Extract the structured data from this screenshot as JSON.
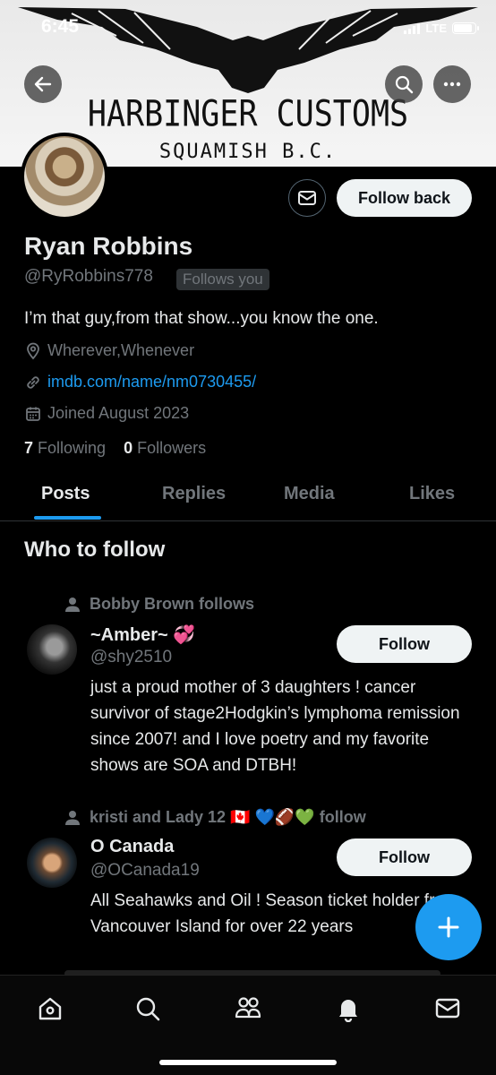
{
  "status_bar": {
    "time": "6:45",
    "network": "LTE"
  },
  "banner": {
    "line1": "HARBINGER CUSTOMS",
    "line2": "SQUAMISH B.C."
  },
  "icons": {
    "back": "back-arrow-icon",
    "search": "search-icon",
    "more": "more-icon",
    "message": "envelope-icon"
  },
  "profile": {
    "name": "Ryan Robbins",
    "handle": "@RyRobbins778",
    "follows_you": "Follows you",
    "bio": "I’m that guy,from that show...you know the one.",
    "location": "Wherever,Whenever",
    "website": "imdb.com/name/nm0730455/",
    "joined": "Joined August 2023",
    "following_count": "7",
    "following_label": "Following",
    "followers_count": "0",
    "followers_label": "Followers",
    "follow_back_label": "Follow back"
  },
  "tabs": [
    "Posts",
    "Replies",
    "Media",
    "Likes"
  ],
  "who_to_follow": {
    "title": "Who to follow",
    "suggestions": [
      {
        "social_context": "Bobby Brown follows",
        "name": "~Amber~ 💞",
        "handle": "@shy2510",
        "bio": "just a proud mother of 3 daughters ! cancer survivor of stage2Hodgkin’s lymphoma remission since 2007! and I love poetry and my favorite shows are SOA and DTBH!",
        "follow_label": "Follow"
      },
      {
        "social_context": "kristi and Lady 12 🇨🇦 💙🏈💚 follow",
        "name": "O Canada",
        "handle": "@OCanada19",
        "bio": "All Seahawks and Oil ! Season ticket holder from Vancouver Island for over 22 years",
        "follow_label": "Follow"
      }
    ]
  },
  "colors": {
    "accent": "#1d9bf0",
    "background": "#000000",
    "muted": "#71767b",
    "text": "#e7e9ea"
  }
}
